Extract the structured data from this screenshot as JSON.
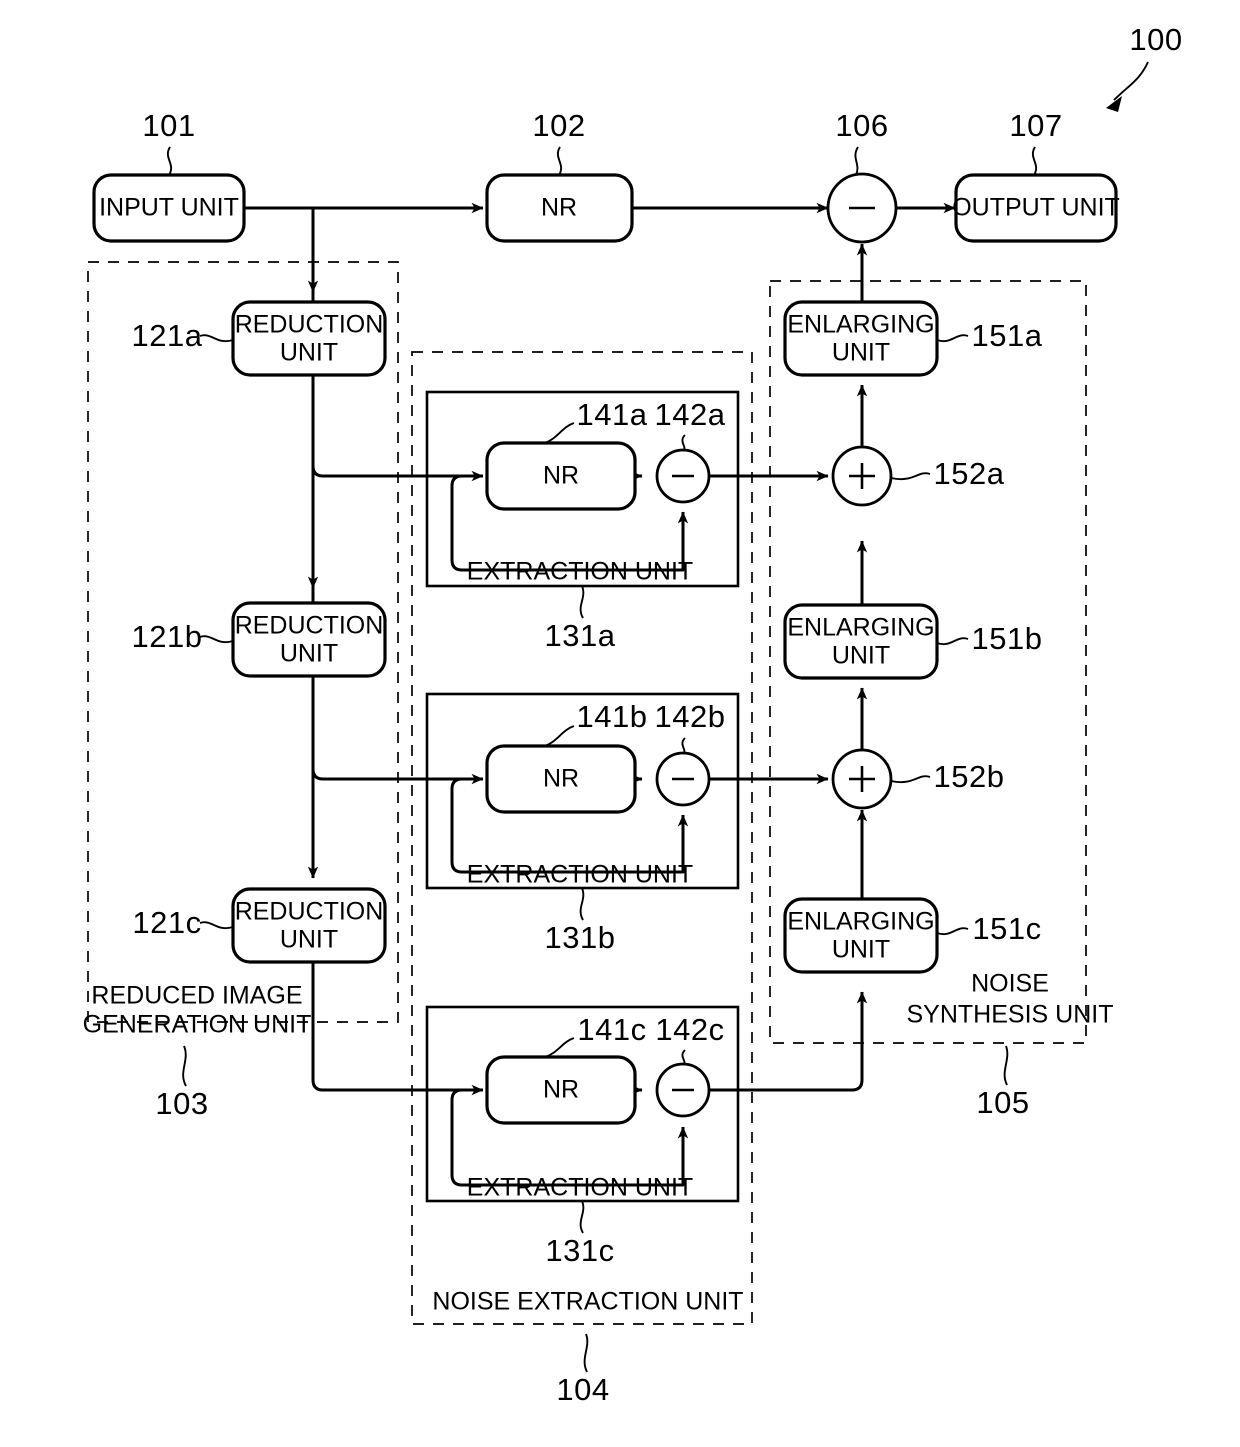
{
  "figure": {
    "overall_ref": "100",
    "type": "patent-block-diagram",
    "title": "Noise reduction apparatus block diagram"
  },
  "blocks": {
    "input_unit": {
      "label": "INPUT UNIT",
      "ref": "101"
    },
    "nr_main": {
      "label": "NR",
      "ref": "102"
    },
    "output_unit": {
      "label": "OUTPUT UNIT",
      "ref": "107"
    },
    "subtractor_main": {
      "symbol": "−",
      "ref": "106"
    },
    "reduction_a": {
      "label_line1": "REDUCTION",
      "label_line2": "UNIT",
      "ref": "121a"
    },
    "reduction_b": {
      "label_line1": "REDUCTION",
      "label_line2": "UNIT",
      "ref": "121b"
    },
    "reduction_c": {
      "label_line1": "REDUCTION",
      "label_line2": "UNIT",
      "ref": "121c"
    },
    "nr_a": {
      "label": "NR",
      "ref": "141a"
    },
    "nr_b": {
      "label": "NR",
      "ref": "141b"
    },
    "nr_c": {
      "label": "NR",
      "ref": "141c"
    },
    "sub_a": {
      "symbol": "−",
      "ref": "142a"
    },
    "sub_b": {
      "symbol": "−",
      "ref": "142b"
    },
    "sub_c": {
      "symbol": "−",
      "ref": "142c"
    },
    "extraction_a": {
      "label": "EXTRACTION UNIT",
      "ref": "131a"
    },
    "extraction_b": {
      "label": "EXTRACTION UNIT",
      "ref": "131b"
    },
    "extraction_c": {
      "label": "EXTRACTION UNIT",
      "ref": "131c"
    },
    "enlarging_a": {
      "label_line1": "ENLARGING",
      "label_line2": "UNIT",
      "ref": "151a"
    },
    "enlarging_b": {
      "label_line1": "ENLARGING",
      "label_line2": "UNIT",
      "ref": "151b"
    },
    "enlarging_c": {
      "label_line1": "ENLARGING",
      "label_line2": "UNIT",
      "ref": "151c"
    },
    "adder_a": {
      "symbol": "+",
      "ref": "152a"
    },
    "adder_b": {
      "symbol": "+",
      "ref": "152b"
    },
    "adder_c_note": "level c feeds enlarging unit 151c directly"
  },
  "groups": {
    "reduced_image_generation_unit": {
      "label_line1": "REDUCED IMAGE",
      "label_line2": "GENERATION UNIT",
      "ref": "103"
    },
    "noise_extraction_unit": {
      "label": "NOISE EXTRACTION UNIT",
      "ref": "104"
    },
    "noise_synthesis_unit": {
      "label_line1": "NOISE",
      "label_line2": "SYNTHESIS UNIT",
      "ref": "105"
    }
  },
  "colors": {
    "line": "#000000",
    "fill": "#ffffff",
    "background": "#ffffff"
  }
}
